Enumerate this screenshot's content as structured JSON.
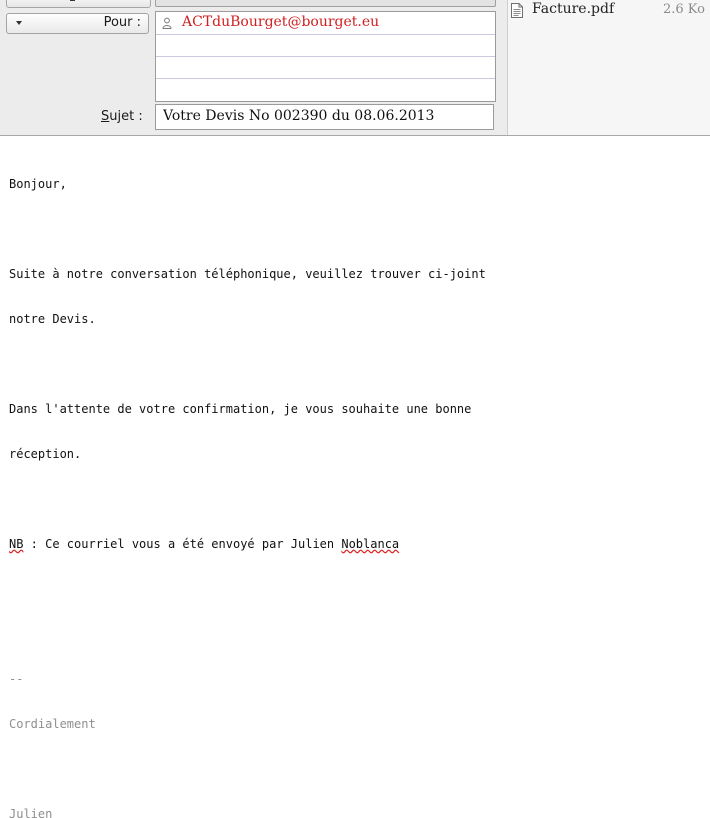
{
  "compose": {
    "recipient_type": "Pour :",
    "recipients": [
      "ACTduBourget@bourget.eu",
      "",
      "",
      ""
    ],
    "subject_label_prefix": "S",
    "subject_label_rest": "ujet :",
    "subject": "Votre Devis No 002390 du 08.06.2013"
  },
  "attachments": [
    {
      "name": "Facture.pdf",
      "size": "2.6 Ko",
      "icon": "document-icon"
    }
  ],
  "body": {
    "greeting": "Bonjour,",
    "para1_line1": "Suite à notre conversation téléphonique, veuillez trouver ci-joint",
    "para1_line2": "notre Devis.",
    "para2_line1": "Dans l'attente de votre confirmation, je vous souhaite une bonne",
    "para2_line2": "réception.",
    "nb_word1": "NB",
    "nb_middle": " : Ce courriel vous a été envoyé par Julien ",
    "nb_word2": "Noblanca",
    "sig_sep": "--",
    "sig_line1": "Cordialement",
    "sig_line2": "Julien"
  },
  "colors": {
    "recipient_text": "#d12020",
    "header_bg": "#ececec",
    "signature_text": "#8f8f8f",
    "spellcheck": "#e02020"
  }
}
